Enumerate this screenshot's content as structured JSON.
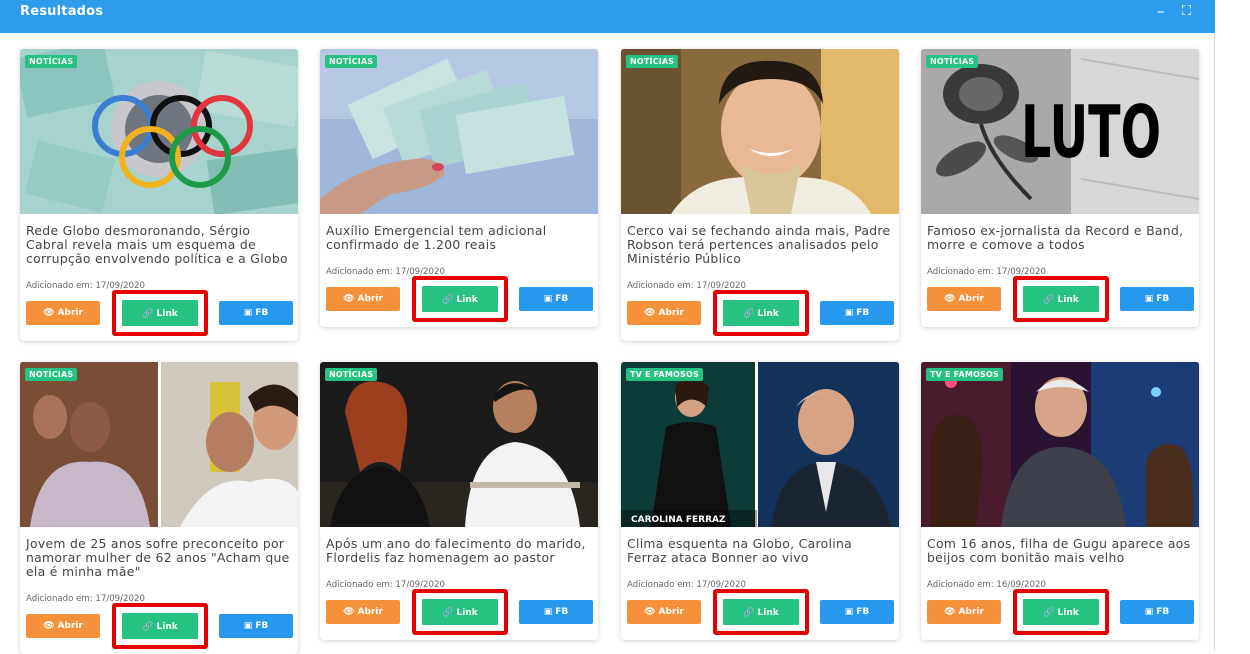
{
  "panel": {
    "title": "Resultados",
    "minimize_label": "–",
    "maximize_label": "⛶"
  },
  "buttons": {
    "open_label": "Abrir",
    "link_label": "Link",
    "fb_label": "FB"
  },
  "colors": {
    "header": "#2d9cec",
    "badge": "#25c281",
    "open": "#f6913b",
    "link": "#25c281",
    "fb": "#2698ee",
    "highlight": "#e60000"
  },
  "cards": [
    {
      "category": "NOTÍCIAS",
      "title": "Rede Globo desmoronando, Sérgio Cabral revela mais um esquema de corrupção envolvendo política e a Globo",
      "date": "Adicionado em: 17/09/2020"
    },
    {
      "category": "NOTÍCIAS",
      "title": "Auxílio Emergencial tem adicional confirmado de 1.200 reais",
      "date": "Adicionado em: 17/09/2020"
    },
    {
      "category": "NOTÍCIAS",
      "title": "Cerco vai se fechando ainda mais, Padre Robson terá pertences analisados pelo Ministério Público",
      "date": "Adicionado em: 17/09/2020"
    },
    {
      "category": "NOTÍCIAS",
      "title": "Famoso ex-jornalista da Record e Band, morre e comove a todos",
      "date": "Adicionado em: 17/09/2020",
      "image_text": "LUTO"
    },
    {
      "category": "NOTÍCIAS",
      "title": "Jovem de 25 anos sofre preconceito por namorar mulher de 62 anos \"Acham que ela é minha mãe\"",
      "date": "Adicionado em: 17/09/2020"
    },
    {
      "category": "NOTÍCIAS",
      "title": "Após um ano do falecimento do marido, Flordelis faz homenagem ao pastor",
      "date": "Adicionado em: 17/09/2020"
    },
    {
      "category": "TV E FAMOSOS",
      "title": "Clima esquenta na Globo, Carolina Ferraz ataca Bonner ao vivo",
      "date": "Adicionado em: 17/09/2020",
      "image_text": "CAROLINA FERRAZ"
    },
    {
      "category": "TV E FAMOSOS",
      "title": "Com 16 anos, filha de Gugu aparece aos beijos com bonitão mais velho",
      "date": "Adicionado em: 16/09/2020"
    }
  ]
}
